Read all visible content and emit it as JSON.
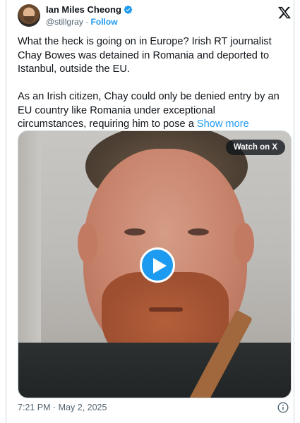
{
  "author": {
    "name": "Ian Miles Cheong",
    "handle": "@stillgray",
    "separator": "·",
    "follow_label": "Follow",
    "verified_icon": "verified-badge-icon"
  },
  "brand": {
    "logo": "x-logo-icon"
  },
  "tweet": {
    "paragraph1": "What the heck is going on in Europe? Irish RT journalist Chay Bowes was detained in Romania and deported to Istanbul, outside the EU.",
    "paragraph2": "As an Irish citizen, Chay could only be denied entry by an EU country like Romania under exceptional circumstances, requiring him to pose a ",
    "show_more": "Show more"
  },
  "media": {
    "watch_label": "Watch on X",
    "play_icon": "play-icon"
  },
  "footer": {
    "timestamp": "7:21 PM · May 2, 2025",
    "info_icon": "info-icon"
  },
  "colors": {
    "accent": "#1d9bf0",
    "text": "#0f1419",
    "muted": "#536471",
    "border": "#cfd9de"
  }
}
